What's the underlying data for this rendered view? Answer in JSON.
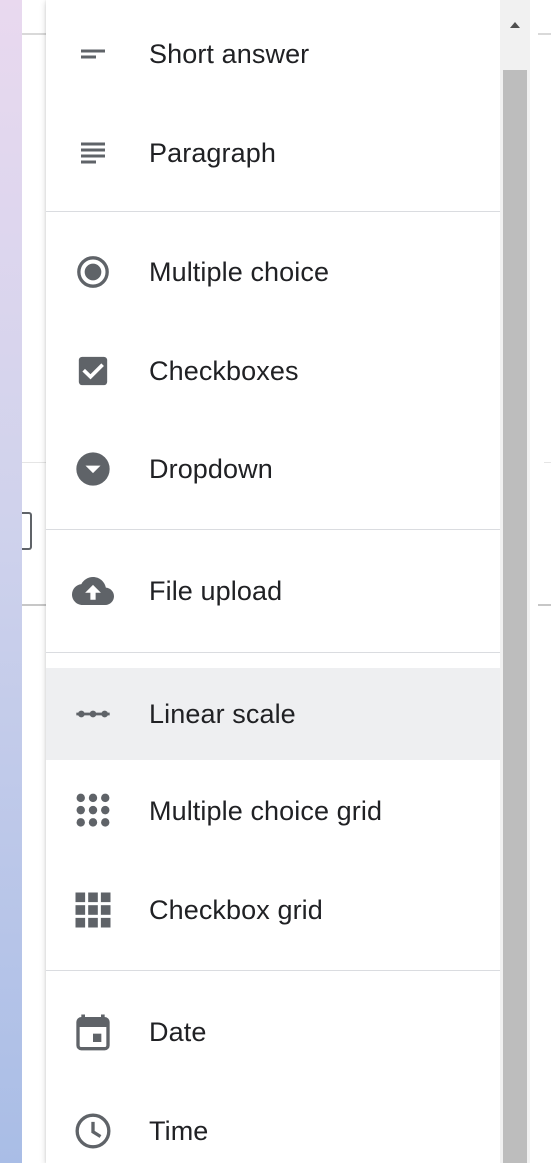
{
  "menu": {
    "items": [
      {
        "label": "Short answer",
        "icon": "short-answer-icon"
      },
      {
        "label": "Paragraph",
        "icon": "paragraph-icon"
      },
      {
        "label": "Multiple choice",
        "icon": "radio-button-icon"
      },
      {
        "label": "Checkboxes",
        "icon": "checkbox-icon"
      },
      {
        "label": "Dropdown",
        "icon": "dropdown-icon"
      },
      {
        "label": "File upload",
        "icon": "cloud-upload-icon"
      },
      {
        "label": "Linear scale",
        "icon": "linear-scale-icon"
      },
      {
        "label": "Multiple choice grid",
        "icon": "dot-grid-icon"
      },
      {
        "label": "Checkbox grid",
        "icon": "square-grid-icon"
      },
      {
        "label": "Date",
        "icon": "calendar-icon"
      },
      {
        "label": "Time",
        "icon": "clock-icon"
      }
    ],
    "highlighted": "Linear scale"
  },
  "colors": {
    "icon": "#5f6368",
    "text": "#202124",
    "highlight": "#eeeff1",
    "separator": "#dadce0"
  }
}
